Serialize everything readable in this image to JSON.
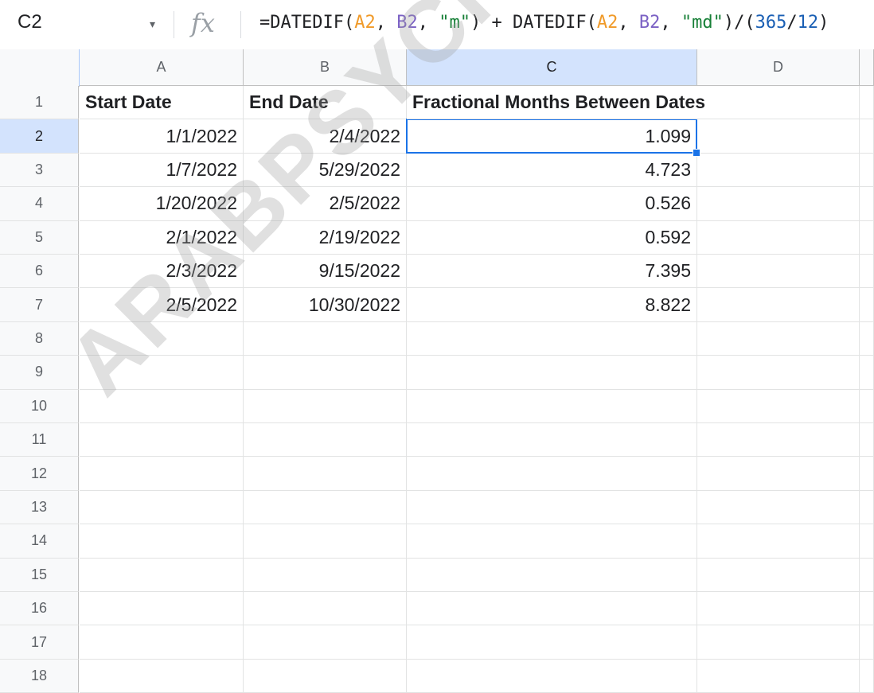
{
  "name_box": "C2",
  "fx_label": "fx",
  "formula": {
    "parts": [
      {
        "t": "=DATEDIF(",
        "c": ""
      },
      {
        "t": "A2",
        "c": "ref1"
      },
      {
        "t": ", ",
        "c": ""
      },
      {
        "t": "B2",
        "c": "ref2"
      },
      {
        "t": ", ",
        "c": ""
      },
      {
        "t": "\"m\"",
        "c": "str"
      },
      {
        "t": ") + DATEDIF(",
        "c": ""
      },
      {
        "t": "A2",
        "c": "ref1"
      },
      {
        "t": ", ",
        "c": ""
      },
      {
        "t": "B2",
        "c": "ref2"
      },
      {
        "t": ", ",
        "c": ""
      },
      {
        "t": "\"md\"",
        "c": "str"
      },
      {
        "t": ")/(",
        "c": ""
      },
      {
        "t": "365",
        "c": "num"
      },
      {
        "t": "/",
        "c": ""
      },
      {
        "t": "12",
        "c": "num"
      },
      {
        "t": ")",
        "c": ""
      }
    ]
  },
  "columns": [
    "A",
    "B",
    "C",
    "D"
  ],
  "active_column": "C",
  "rows": [
    "1",
    "2",
    "3",
    "4",
    "5",
    "6",
    "7",
    "8",
    "9",
    "10",
    "11",
    "12",
    "13",
    "14",
    "15",
    "16",
    "17",
    "18"
  ],
  "active_row": "2",
  "headers": {
    "a": "Start Date",
    "b": "End Date",
    "c": "Fractional Months Between Dates"
  },
  "data_rows": [
    {
      "a": "1/1/2022",
      "b": "2/4/2022",
      "c": "1.099"
    },
    {
      "a": "1/7/2022",
      "b": "5/29/2022",
      "c": "4.723"
    },
    {
      "a": "1/20/2022",
      "b": "2/5/2022",
      "c": "0.526"
    },
    {
      "a": "2/1/2022",
      "b": "2/19/2022",
      "c": "0.592"
    },
    {
      "a": "2/3/2022",
      "b": "9/15/2022",
      "c": "7.395"
    },
    {
      "a": "2/5/2022",
      "b": "10/30/2022",
      "c": "8.822"
    }
  ],
  "watermark": "ARABPSYCHOLOGY.C",
  "colors": {
    "selection": "#1a73e8",
    "ref_a2": "#f09a29",
    "ref_b2": "#7b61c4",
    "string": "#188038",
    "number": "#1a5fb4"
  }
}
